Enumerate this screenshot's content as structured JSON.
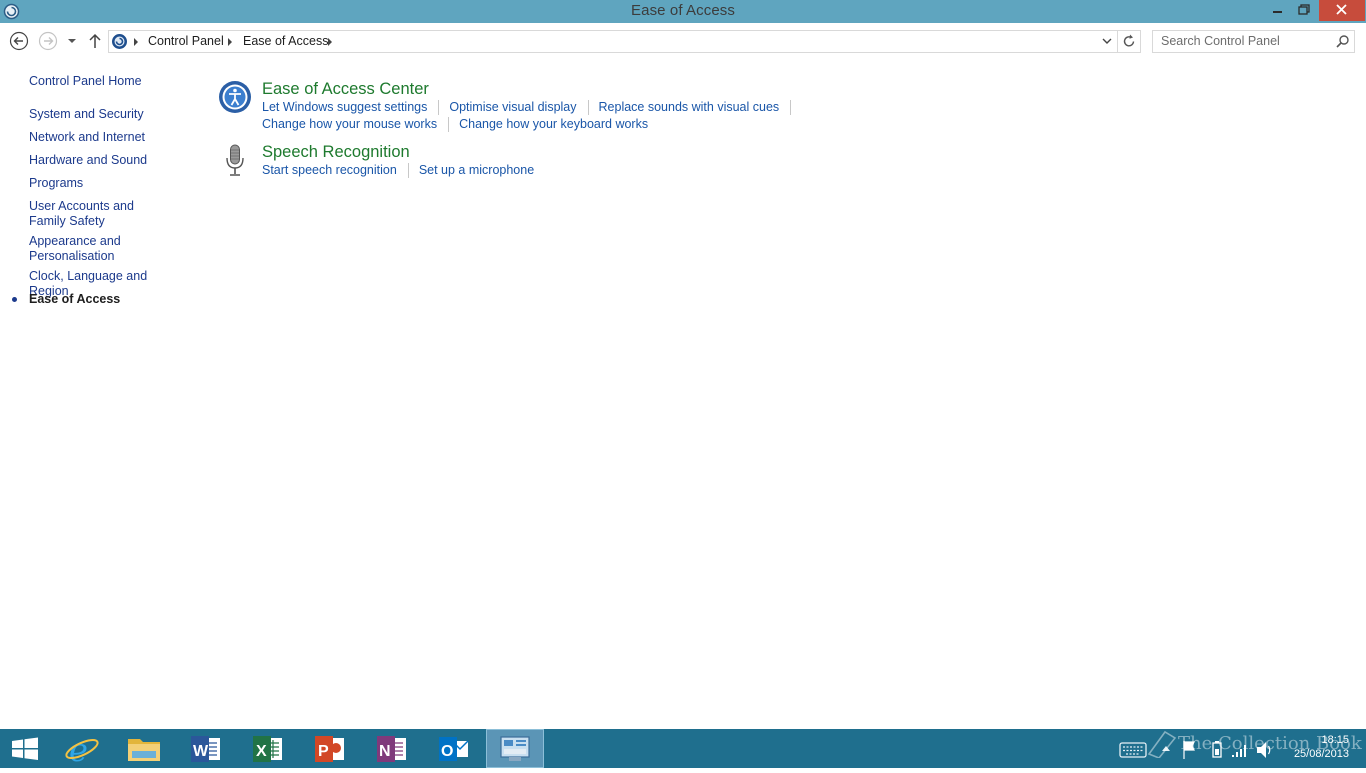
{
  "window": {
    "title": "Ease of Access"
  },
  "address_bar": {
    "breadcrumbs": [
      "Control Panel",
      "Ease of Access"
    ],
    "search_placeholder": "Search Control Panel"
  },
  "sidebar": {
    "home": "Control Panel Home",
    "items": [
      {
        "label": "System and Security"
      },
      {
        "label": "Network and Internet"
      },
      {
        "label": "Hardware and Sound"
      },
      {
        "label": "Programs"
      },
      {
        "label": "User Accounts and Family Safety"
      },
      {
        "label": "Appearance and Personalisation"
      },
      {
        "label": "Clock, Language and Region"
      },
      {
        "label": "Ease of Access"
      }
    ]
  },
  "main": {
    "sections": [
      {
        "title": "Ease of Access Center",
        "icon": "ease-of-access-icon",
        "links": [
          "Let Windows suggest settings",
          "Optimise visual display",
          "Replace sounds with visual cues",
          "Change how your mouse works",
          "Change how your keyboard works"
        ]
      },
      {
        "title": "Speech Recognition",
        "icon": "microphone-icon",
        "links": [
          "Start speech recognition",
          "Set up a microphone"
        ]
      }
    ]
  },
  "taskbar": {
    "apps": [
      "start",
      "internet-explorer",
      "file-explorer",
      "word",
      "excel",
      "powerpoint",
      "onenote",
      "outlook",
      "control-panel"
    ],
    "time": "18:15",
    "date": "25/08/2013",
    "watermark": "The Collection Book"
  },
  "colors": {
    "titlebar": "#5fa5bf",
    "close_button": "#c74c3c",
    "taskbar": "#1f6f8e",
    "heading_green": "#1e7a2e",
    "link_blue": "#1a56a8",
    "nav_blue": "#1c3a8c"
  }
}
